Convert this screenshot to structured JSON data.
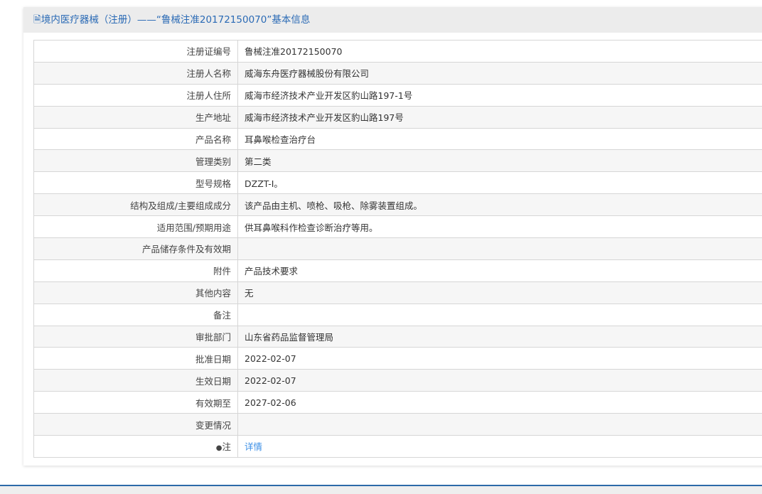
{
  "header": {
    "icon": "document-icon",
    "title": "境内医疗器械（注册）——“鲁械注准20172150070”基本信息"
  },
  "rows": [
    {
      "label": "注册证编号",
      "value": "鲁械注准20172150070"
    },
    {
      "label": "注册人名称",
      "value": "威海东舟医疗器械股份有限公司"
    },
    {
      "label": "注册人住所",
      "value": "威海市经济技术产业开发区豹山路197-1号"
    },
    {
      "label": "生产地址",
      "value": "威海市经济技术产业开发区豹山路197号"
    },
    {
      "label": "产品名称",
      "value": "耳鼻喉检查治疗台"
    },
    {
      "label": "管理类别",
      "value": "第二类"
    },
    {
      "label": "型号规格",
      "value": "DZZT-I。"
    },
    {
      "label": "结构及组成/主要组成成分",
      "value": "该产品由主机、喷枪、吸枪、除雾装置组成。"
    },
    {
      "label": "适用范围/预期用途",
      "value": "供耳鼻喉科作检查诊断治疗等用。"
    },
    {
      "label": "产品储存条件及有效期",
      "value": ""
    },
    {
      "label": "附件",
      "value": "产品技术要求"
    },
    {
      "label": "其他内容",
      "value": "无"
    },
    {
      "label": "备注",
      "value": ""
    },
    {
      "label": "审批部门",
      "value": "山东省药品监督管理局"
    },
    {
      "label": "批准日期",
      "value": "2022-02-07"
    },
    {
      "label": "生效日期",
      "value": "2022-02-07"
    },
    {
      "label": "有效期至",
      "value": "2027-02-06"
    },
    {
      "label": "变更情况",
      "value": ""
    }
  ],
  "note": {
    "label": "注",
    "link": "详情"
  }
}
